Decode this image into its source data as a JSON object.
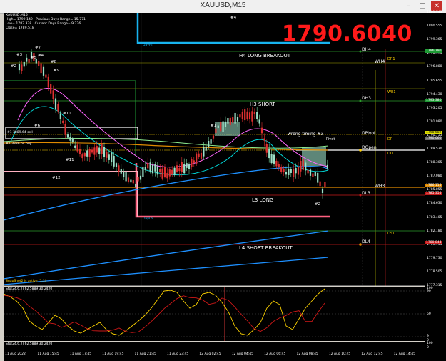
{
  "window": {
    "title": "XAUUSD,M15",
    "minimize_icon": "minimize-icon",
    "maximize_icon": "maximize-icon",
    "close_icon": "close-icon"
  },
  "info": {
    "symbol": "XAUUSD,M15",
    "high": "High= 1799.149",
    "low": "Low= 1783.378",
    "close": "Close= 1789.518",
    "prev_range": "Previous Days Range= 15.771",
    "curr_range": "Current Days Range= 9.226"
  },
  "big_price": "1790.6040",
  "chart_labels": {
    "h4_long": "H4 LONG BREAKOUT",
    "h3_short": "H3 SHORT",
    "l3_long": "L3 LONG",
    "l4_short": "L4 SHORT BREAKOUT",
    "wrong_timing": "wrong timing #3",
    "pivot": "Pivot",
    "dayhi": "DayHi",
    "daylo": "DayLo",
    "snapshot": "SnapShot2 is active (1.1)",
    "sell_label": "#1 3889.64 sell",
    "buy_label": "#1 3889.64 buy"
  },
  "levels": [
    "DH4",
    "WH4",
    "DR1",
    "WR1",
    "DH3",
    "DPivot",
    "DP",
    "DOpen",
    "DO",
    "WH3",
    "DL3",
    "DS1",
    "DL4"
  ],
  "trade_markers": [
    "#4",
    "#7",
    "#3",
    "#2",
    "#5",
    "#8",
    "#9",
    "#6",
    "#10",
    "#11",
    "#12",
    "#1",
    "#4",
    "#2"
  ],
  "price_ticks": [
    "1801.745",
    "1800.555",
    "1799.365",
    "1798.175",
    "1796.880",
    "1795.655",
    "1794.430",
    "1793.205",
    "1791.980",
    "1790.755",
    "1789.530",
    "1788.305",
    "1787.080",
    "1785.855",
    "1784.630",
    "1783.405",
    "1782.180",
    "1780.955",
    "1779.730",
    "1778.505",
    "1777.315"
  ],
  "price_badges": [
    {
      "text": "1796.790",
      "color": "#1e9a35"
    },
    {
      "text": "1793.380",
      "color": "#1e9a35"
    },
    {
      "text": "1790.682",
      "color": "#dede00"
    },
    {
      "text": "1790.060",
      "color": "#6b6b6b"
    },
    {
      "text": "1786.115",
      "color": "#e08a00"
    },
    {
      "text": "1785.355",
      "color": "#c81b1b"
    },
    {
      "text": "1780.844",
      "color": "#c81b1b"
    }
  ],
  "osc1": {
    "label": "Sto(24,6,2) 62.5889 30.2420",
    "ticks": [
      "100",
      "90",
      "50",
      "9",
      "0"
    ]
  },
  "osc2": {
    "label": "Sto(24,6,2) 62.5889 30.2420",
    "ticks": [
      "100",
      "0"
    ]
  },
  "time_ticks": [
    "11 Aug 2022",
    "11 Aug 15:45",
    "11 Aug 17:45",
    "11 Aug 19:45",
    "11 Aug 21:45",
    "11 Aug 23:45",
    "12 Aug 02:45",
    "12 Aug 04:45",
    "12 Aug 06:45",
    "12 Aug 08:45",
    "12 Aug 10:45",
    "12 Aug 12:45",
    "12 Aug 14:45"
  ]
}
